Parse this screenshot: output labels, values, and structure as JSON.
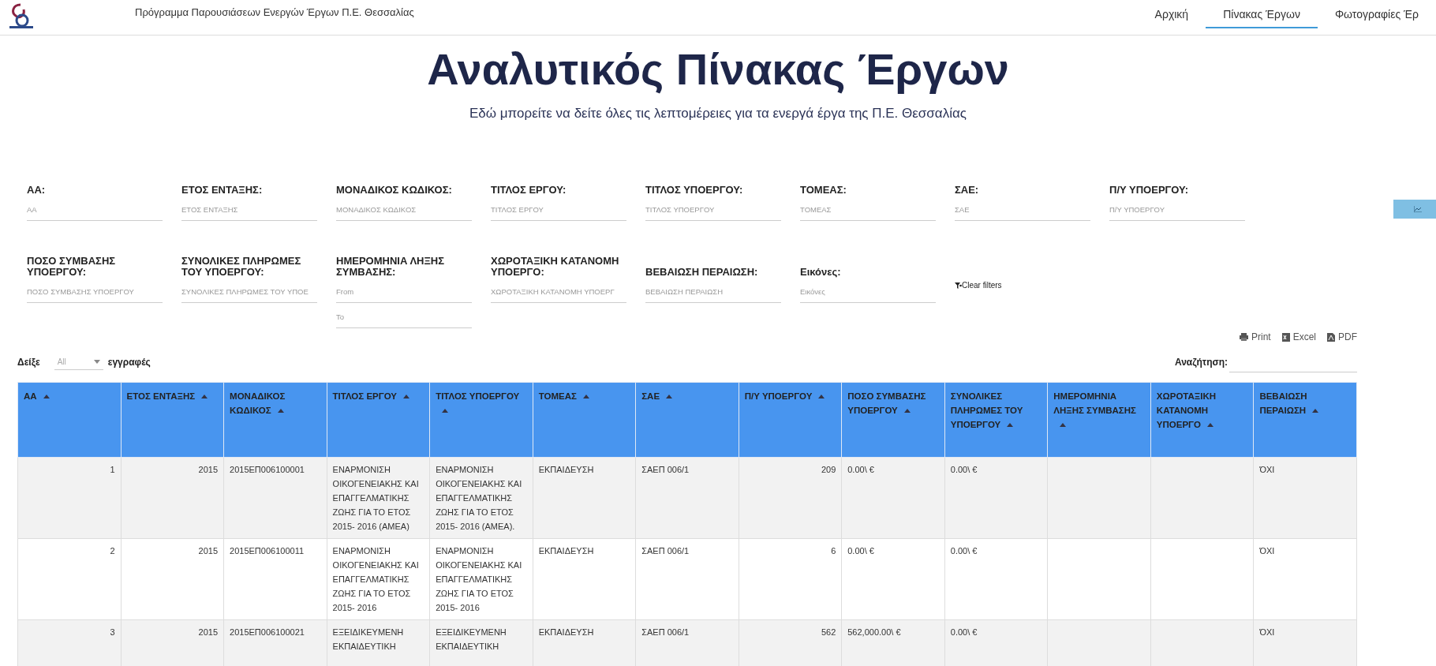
{
  "header": {
    "site_title": "Πρόγραμμα Παρουσιάσεων Ενεργών Έργων Π.Ε. Θεσσαλίας",
    "nav": [
      {
        "label": "Αρχική",
        "selected": false
      },
      {
        "label": "Πίνακας Έργων",
        "selected": true
      },
      {
        "label": "Φωτογραφίες Έρ",
        "selected": false
      }
    ]
  },
  "heading": "Αναλυτικός Πίνακας Έργων",
  "subtitle": "Εδώ μπορείτε να δείτε όλες τις λεπτομέρειες για τα ενεργά έργα της Π.Ε. Θεσσαλίας",
  "filters": [
    {
      "kind": "text",
      "label": "ΑΑ:",
      "placeholder": "ΑΑ"
    },
    {
      "kind": "text",
      "label": "ΕΤΟΣ ΕΝΤΑΞΗΣ:",
      "placeholder": "ΕΤΟΣ ΕΝΤΑΞΗΣ"
    },
    {
      "kind": "text",
      "label": "ΜΟΝΑΔΙΚΟΣ ΚΩΔΙΚΟΣ:",
      "placeholder": "ΜΟΝΑΔΙΚΟΣ ΚΩΔΙΚΟΣ"
    },
    {
      "kind": "text",
      "label": "ΤΙΤΛΟΣ ΕΡΓΟΥ:",
      "placeholder": "ΤΙΤΛΟΣ ΕΡΓΟΥ"
    },
    {
      "kind": "text",
      "label": "ΤΙΤΛΟΣ ΥΠΟΕΡΓΟΥ:",
      "placeholder": "ΤΙΤΛΟΣ ΥΠΟΕΡΓΟΥ"
    },
    {
      "kind": "text",
      "label": "ΤΟΜΕΑΣ:",
      "placeholder": "ΤΟΜΕΑΣ"
    },
    {
      "kind": "text",
      "label": "ΣΑΕ:",
      "placeholder": "ΣΑΕ"
    },
    {
      "kind": "text",
      "label": "Π/Υ ΥΠΟΕΡΓΟΥ:",
      "placeholder": "Π/Υ ΥΠΟΕΡΓΟΥ"
    },
    {
      "kind": "text",
      "label": "ΠΟΣΟ ΣΥΜΒΑΣΗΣ ΥΠΟΕΡΓΟΥ:",
      "placeholder": "ΠΟΣΟ ΣΥΜΒΑΣΗΣ ΥΠΟΕΡΓΟΥ"
    },
    {
      "kind": "text",
      "label": "ΣΥΝΟΛΙΚΕΣ ΠΛΗΡΩΜΕΣ ΤΟΥ ΥΠΟΕΡΓΟΥ:",
      "placeholder": "ΣΥΝΟΛΙΚΕΣ ΠΛΗΡΩΜΕΣ ΤΟΥ ΥΠΟΕ"
    },
    {
      "kind": "date",
      "label": "ΗΜΕΡΟΜΗΝΙΑ ΛΗΞΗΣ ΣΥΜΒΑΣΗΣ:",
      "placeholder": "From",
      "placeholder_to": "To"
    },
    {
      "kind": "text",
      "label": "ΧΩΡΟΤΑΞΙΚΗ ΚΑΤΑΝΟΜΗ ΥΠΟΕΡΓΟ:",
      "placeholder": "ΧΩΡΟΤΑΞΙΚΗ ΚΑΤΑΝΟΜΗ ΥΠΟΕΡΓ"
    },
    {
      "kind": "text",
      "label": "ΒΕΒΑΙΩΣΗ ΠΕΡΑΙΩΣΗ:",
      "placeholder": "ΒΕΒΑΙΩΣΗ ΠΕΡΑΙΩΣΗ"
    },
    {
      "kind": "text",
      "label": "Εικόνες:",
      "placeholder": "Εικόνες"
    }
  ],
  "clear_filters": "Clear filters",
  "exports": [
    {
      "kind": "print",
      "label": "Print"
    },
    {
      "kind": "excel",
      "label": "Excel"
    },
    {
      "kind": "pdf",
      "label": "PDF"
    }
  ],
  "length": {
    "prefix": "Δείξε",
    "value": "All",
    "suffix": "εγγραφές"
  },
  "search": {
    "label": "Αναζήτηση:"
  },
  "table": {
    "columns": [
      {
        "label": "ΑΑ",
        "kind": "number"
      },
      {
        "label": "ΕΤΟΣ ΕΝΤΑΞΗΣ",
        "kind": "number"
      },
      {
        "label": "ΜΟΝΑΔΙΚΟΣ ΚΩΔΙΚΟΣ",
        "kind": "text"
      },
      {
        "label": "ΤΙΤΛΟΣ ΕΡΓΟΥ",
        "kind": "text"
      },
      {
        "label": "ΤΙΤΛΟΣ ΥΠΟΕΡΓΟΥ",
        "kind": "text"
      },
      {
        "label": "ΤΟΜΕΑΣ",
        "kind": "text"
      },
      {
        "label": "ΣΑΕ",
        "kind": "text"
      },
      {
        "label": "Π/Υ ΥΠΟΕΡΓΟΥ",
        "kind": "number"
      },
      {
        "label": "ΠΟΣΟ ΣΥΜΒΑΣΗΣ ΥΠΟΕΡΓΟΥ",
        "kind": "text"
      },
      {
        "label": "ΣΥΝΟΛΙΚΕΣ ΠΛΗΡΩΜΕΣ ΤΟΥ ΥΠΟΕΡΓΟΥ",
        "kind": "text"
      },
      {
        "label": "ΗΜΕΡΟΜΗΝΙΑ ΛΗΞΗΣ ΣΥΜΒΑΣΗΣ",
        "kind": "text"
      },
      {
        "label": "ΧΩΡΟΤΑΞΙΚΗ ΚΑΤΑΝΟΜΗ ΥΠΟΕΡΓΟ",
        "kind": "text"
      },
      {
        "label": "ΒΕΒΑΙΩΣΗ ΠΕΡΑΙΩΣΗ",
        "kind": "text"
      }
    ],
    "rows": [
      [
        "1",
        "2015",
        "2015ΕΠ006100001",
        "ΕΝΑΡΜΟΝΙΣΗ ΟΙΚΟΓΕΝΕΙΑΚΗΣ ΚΑΙ ΕΠΑΓΓΕΛΜΑΤΙΚΗΣ ΖΩΗΣ ΓΙΑ ΤΟ ΕΤΟΣ 2015- 2016 (ΑΜΕΑ)",
        "ΕΝΑΡΜΟΝΙΣΗ ΟΙΚΟΓΕΝΕΙΑΚΗΣ ΚΑΙ ΕΠΑΓΓΕΛΜΑΤΙΚΗΣ ΖΩΗΣ ΓΙΑ ΤΟ ΕΤΟΣ 2015- 2016 (ΑΜΕΑ).",
        "ΕΚΠΑΙΔΕΥΣΗ",
        "ΣΑΕΠ 006/1",
        "209",
        "0.00\\ €",
        "0.00\\ €",
        "",
        "",
        "ΌΧΙ"
      ],
      [
        "2",
        "2015",
        "2015ΕΠ006100011",
        "ΕΝΑΡΜΟΝΙΣΗ ΟΙΚΟΓΕΝΕΙΑΚΗΣ ΚΑΙ ΕΠΑΓΓΕΛΜΑΤΙΚΗΣ ΖΩΗΣ ΓΙΑ ΤΟ ΕΤΟΣ 2015- 2016",
        "ΕΝΑΡΜΟΝΙΣΗ ΟΙΚΟΓΕΝΕΙΑΚΗΣ ΚΑΙ ΕΠΑΓΓΕΛΜΑΤΙΚΗΣ ΖΩΗΣ ΓΙΑ ΤΟ ΕΤΟΣ 2015- 2016",
        "ΕΚΠΑΙΔΕΥΣΗ",
        "ΣΑΕΠ 006/1",
        "6",
        "0.00\\ €",
        "0.00\\ €",
        "",
        "",
        "ΌΧΙ"
      ],
      [
        "3",
        "2015",
        "2015ΕΠ006100021",
        "ΕΞΕΙΔΙΚΕΥΜΕΝΗ ΕΚΠΑΙΔΕΥΤΙΚΗ",
        "ΕΞΕΙΔΙΚΕΥΜΕΝΗ ΕΚΠΑΙΔΕΥΤΙΚΗ",
        "ΕΚΠΑΙΔΕΥΣΗ",
        "ΣΑΕΠ 006/1",
        "562",
        "562,000.00\\ €",
        "0.00\\ €",
        "",
        "",
        "ΌΧΙ"
      ]
    ]
  }
}
